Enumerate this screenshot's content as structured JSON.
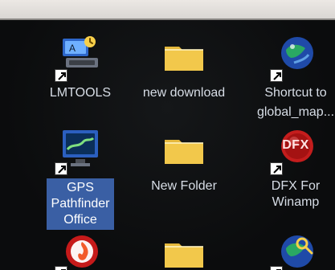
{
  "desktop": {
    "icons": [
      {
        "name": "lmtools",
        "label": "LMTOOLS"
      },
      {
        "name": "new-download",
        "label": "new download"
      },
      {
        "name": "shortcut-global-map",
        "label_line1": "Shortcut to",
        "label_line2": "global_map..."
      },
      {
        "name": "gps-pathfinder-office",
        "label_line1": "GPS",
        "label_line2": "Pathfinder",
        "label_line3": "Office"
      },
      {
        "name": "new-folder",
        "label": "New Folder"
      },
      {
        "name": "dfx-for-winamp",
        "label_line1": "DFX For",
        "label_line2": "Winamp",
        "badge": "DFX"
      }
    ]
  },
  "colors": {
    "background": "#0c0d0e",
    "label": "#d7dde6",
    "selection": "#3a5fa4",
    "folder": "#f2c84b",
    "dfx_red": "#c41d1d"
  }
}
